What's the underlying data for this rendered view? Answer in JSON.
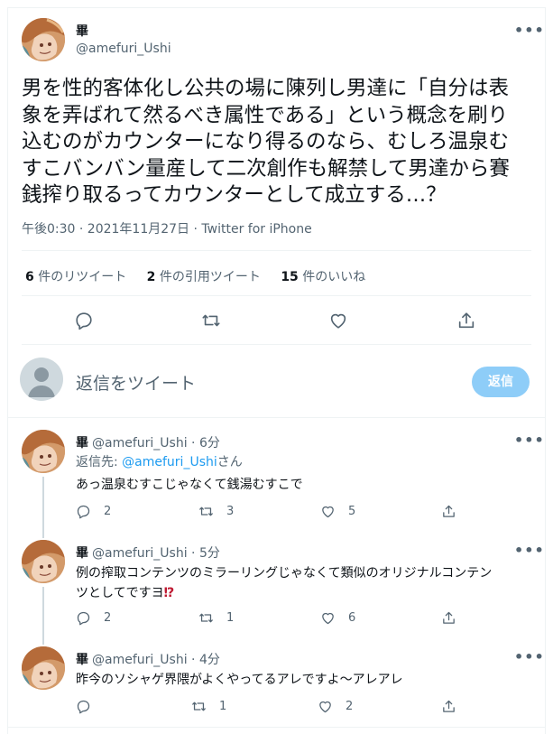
{
  "main": {
    "name": "畢",
    "handle": "@amefuri_Ushi",
    "text": "男を性的客体化し公共の場に陳列し男達に「自分は表象を弄ばれて然るべき属性である」という概念を刷り込むのがカウンターになり得るのなら、むしろ温泉むすこバンバン量産して二次創作も解禁して男達から賽銭搾り取るってカウンターとして成立する…？",
    "meta": "午後0:30 · 2021年11月27日 · Twitter for iPhone",
    "stats": {
      "retweets_count": "6",
      "retweets_label": " 件のリツイート",
      "quotes_count": "2",
      "quotes_label": " 件の引用ツイート",
      "likes_count": "15",
      "likes_label": " 件のいいね"
    }
  },
  "composer": {
    "placeholder": "返信をツイート",
    "button": "返信"
  },
  "replies": [
    {
      "name": "畢",
      "handle": "@amefuri_Ushi",
      "time": " · 6分",
      "reply_to_prefix": "返信先: ",
      "reply_to_handle": "@amefuri_Ushi",
      "reply_to_suffix": "さん",
      "line1": "あっ温泉むすこじゃなくて銭湯むすこで",
      "line2": "",
      "line2_emoji": "",
      "reply_count": "2",
      "retweet_count": "3",
      "like_count": "5"
    },
    {
      "name": "畢",
      "handle": "@amefuri_Ushi",
      "time": " · 5分",
      "line1": "例の搾取コンテンツのミラーリングじゃなくて類似のオリジナルコンテン",
      "line2": "ツとしてですヨ",
      "line2_emoji": "⁉",
      "reply_count": "2",
      "retweet_count": "1",
      "like_count": "6"
    },
    {
      "name": "畢",
      "handle": "@amefuri_Ushi",
      "time": " · 4分",
      "line1": "昨今のソシャゲ界隈がよくやってるアレですよ～アレアレ",
      "reply_count": "",
      "retweet_count": "1",
      "like_count": "2"
    }
  ],
  "colors": {
    "accent": "#1d9bf0",
    "button_disabled": "#8ecdf8",
    "muted": "#536471",
    "border": "#eff3f4"
  },
  "icons": [
    "more-icon",
    "reply-icon",
    "retweet-icon",
    "like-icon",
    "share-icon",
    "default-avatar-icon"
  ]
}
